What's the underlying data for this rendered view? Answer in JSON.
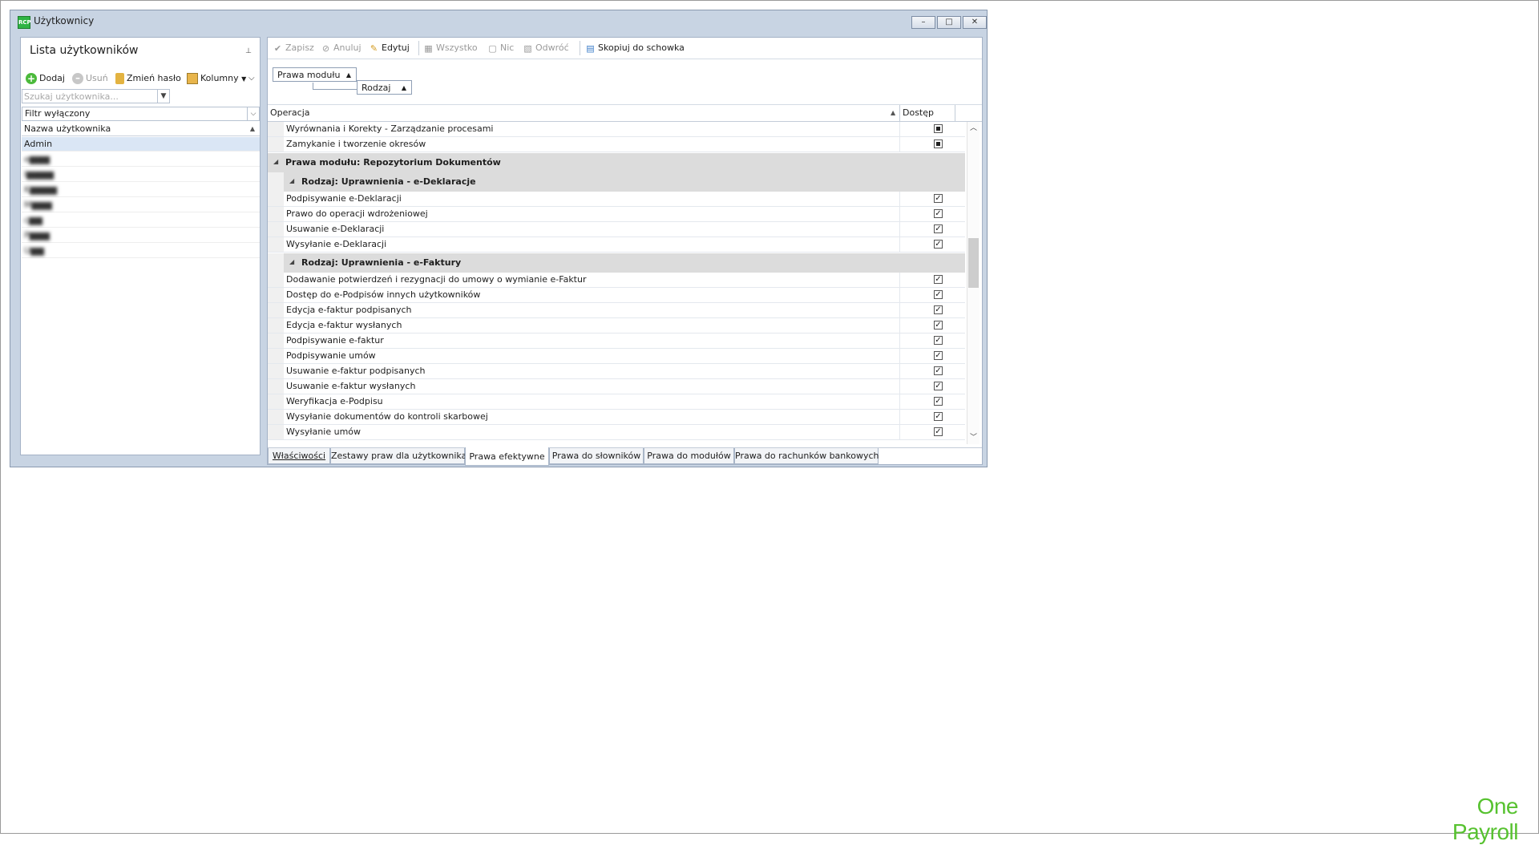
{
  "window": {
    "title": "Użytkownicy",
    "app_icon_text": "RCP",
    "controls": {
      "minimize": "–",
      "maximize": "□",
      "close": "✕"
    }
  },
  "users_panel": {
    "title": "Lista użytkowników",
    "pin": "⊥",
    "toolbar": {
      "add": "Dodaj",
      "delete": "Usuń",
      "change_password": "Zmień hasło",
      "columns": "Kolumny"
    },
    "search": {
      "placeholder": "Szukaj użytkownika...",
      "value": ""
    },
    "filter": "Filtr wyłączony",
    "column_header": "Nazwa użytkownika",
    "users": [
      "Admin",
      "e▆▆▆",
      "I▆▆▆▆",
      "K▆▆▆▆",
      "M▆▆▆",
      "c▆▆",
      "P▆▆▆",
      "U▆▆"
    ]
  },
  "rights_panel": {
    "toolbar": {
      "save": "Zapisz",
      "cancel": "Anuluj",
      "edit": "Edytuj",
      "all": "Wszystko",
      "none": "Nic",
      "invert": "Odwróć",
      "copy": "Skopiuj do schowka"
    },
    "group_chips": [
      "Prawa modułu",
      "Rodzaj"
    ],
    "columns": {
      "operation": "Operacja",
      "access": "Dostęp"
    },
    "rows_top": [
      {
        "label": "Wyrównania i Korekty - Zarządzanie procesami",
        "state": "indeterminate"
      },
      {
        "label": "Zamykanie i tworzenie okresów",
        "state": "indeterminate"
      }
    ],
    "module_group": "Prawa modułu: Repozytorium Dokumentów",
    "kind_group_1": "Rodzaj: Uprawnienia - e-Deklaracje",
    "rows_group_1": [
      {
        "label": "Podpisywanie e-Deklaracji",
        "state": "checked"
      },
      {
        "label": "Prawo do operacji wdrożeniowej",
        "state": "checked"
      },
      {
        "label": "Usuwanie e-Deklaracji",
        "state": "checked"
      },
      {
        "label": "Wysyłanie e-Deklaracji",
        "state": "checked"
      }
    ],
    "kind_group_2": "Rodzaj: Uprawnienia - e-Faktury",
    "rows_group_2": [
      {
        "label": "Dodawanie potwierdzeń i rezygnacji do umowy o wymianie e-Faktur",
        "state": "checked"
      },
      {
        "label": "Dostęp do e-Podpisów innych użytkowników",
        "state": "checked"
      },
      {
        "label": "Edycja e-faktur podpisanych",
        "state": "checked"
      },
      {
        "label": "Edycja e-faktur wysłanych",
        "state": "checked"
      },
      {
        "label": "Podpisywanie e-faktur",
        "state": "checked"
      },
      {
        "label": "Podpisywanie umów",
        "state": "checked"
      },
      {
        "label": "Usuwanie e-faktur podpisanych",
        "state": "checked"
      },
      {
        "label": "Usuwanie e-faktur wysłanych",
        "state": "checked"
      },
      {
        "label": "Weryfikacja e-Podpisu",
        "state": "checked"
      },
      {
        "label": "Wysyłanie dokumentów do kontroli skarbowej",
        "state": "checked"
      },
      {
        "label": "Wysyłanie umów",
        "state": "checked"
      }
    ],
    "tabs": [
      "Właściwości",
      "Zestawy praw dla użytkownika",
      "Prawa efektywne",
      "Prawa do słowników",
      "Prawa do modułów",
      "Prawa do rachunków bankowych"
    ],
    "active_tab": "Prawa efektywne"
  },
  "brand": {
    "logo_text": "One Payroll",
    "color": "#57c230"
  },
  "colors": {
    "window_frame": "#c8d4e3",
    "selection": "#dae6f5",
    "group_band": "#dcdcdc"
  }
}
